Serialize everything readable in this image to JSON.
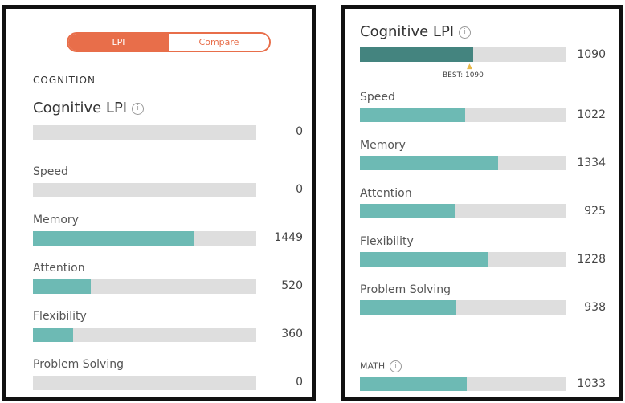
{
  "left": {
    "toggle": {
      "active": "LPI",
      "inactive": "Compare"
    },
    "section": "COGNITION",
    "metrics": [
      {
        "label": "Cognitive LPI",
        "value": "0",
        "fill": 0.0
      },
      {
        "label": "Speed",
        "value": "0",
        "fill": 0.0
      },
      {
        "label": "Memory",
        "value": "1449",
        "fill": 0.72
      },
      {
        "label": "Attention",
        "value": "520",
        "fill": 0.26
      },
      {
        "label": "Flexibility",
        "value": "360",
        "fill": 0.18
      },
      {
        "label": "Problem Solving",
        "value": "0",
        "fill": 0.0
      }
    ]
  },
  "right": {
    "top": {
      "label": "Cognitive LPI",
      "value": "1090",
      "fill": 0.55,
      "best": "BEST: 1090"
    },
    "metrics": [
      {
        "label": "Speed",
        "value": "1022",
        "fill": 0.51
      },
      {
        "label": "Memory",
        "value": "1334",
        "fill": 0.67
      },
      {
        "label": "Attention",
        "value": "925",
        "fill": 0.46
      },
      {
        "label": "Flexibility",
        "value": "1228",
        "fill": 0.62
      },
      {
        "label": "Problem Solving",
        "value": "938",
        "fill": 0.47
      }
    ],
    "math": {
      "label": "MATH",
      "value": "1033",
      "fill": 0.52
    }
  },
  "icons": {
    "info": "info-icon"
  },
  "colors": {
    "accent": "#e86e4a",
    "bar_fill": "#6dbab4",
    "bar_fill_dark": "#44847f",
    "track": "#dedede"
  }
}
